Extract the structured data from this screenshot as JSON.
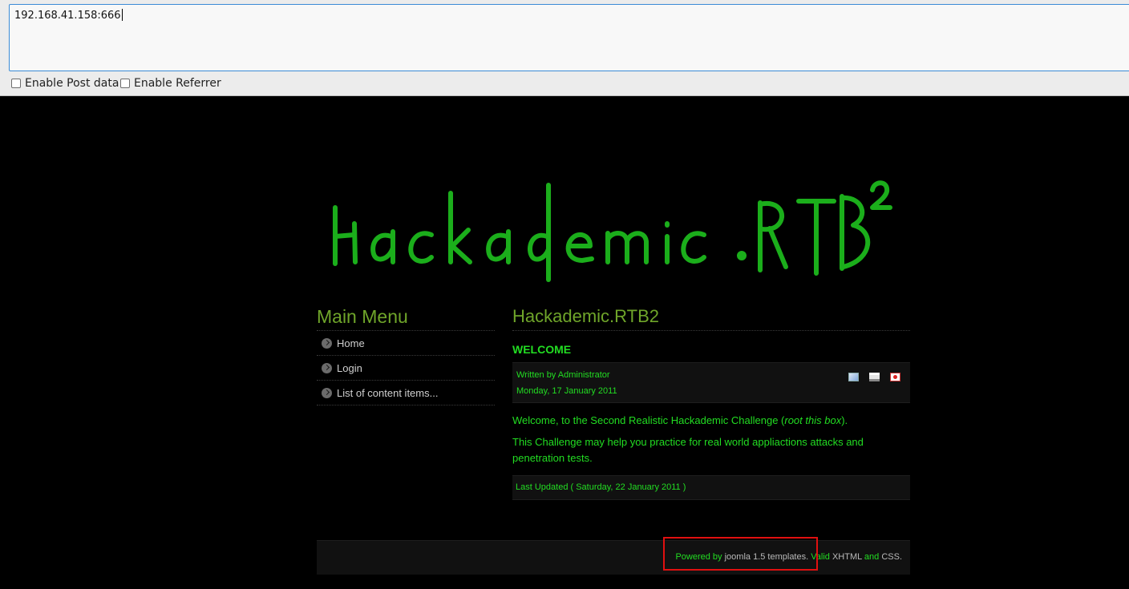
{
  "toolbar": {
    "url_value": "192.168.41.158:666",
    "enable_post_label": "Enable Post data",
    "enable_referrer_label": "Enable Referrer"
  },
  "logo": {
    "text": "Hackademic.RTB",
    "superscript": "2",
    "color": "#1fc11f"
  },
  "menu": {
    "title": "Main Menu",
    "items": [
      {
        "label": "Home"
      },
      {
        "label": "Login"
      },
      {
        "label": "List of content items..."
      }
    ]
  },
  "article": {
    "page_title": "Hackademic.RTB2",
    "heading": "WELCOME",
    "written_by": "Written by Administrator",
    "date": "Monday, 17 January 2011",
    "paragraph1_before": "Welcome, to the Second Realistic Hackademic Challenge (",
    "paragraph1_em": "root this box",
    "paragraph1_after": ").",
    "paragraph2": "This Challenge may help you practice for real world appliactions attacks and penetration tests.",
    "last_updated": "Last Updated ( Saturday, 22 January 2011 )",
    "icons": [
      "email-icon",
      "print-icon",
      "pdf-icon"
    ]
  },
  "footer": {
    "powered_by": "Powered by",
    "joomla": "joomla 1.5 templates",
    "dot": ".",
    "valid": "Valid",
    "xhtml": "XHTML",
    "and": "and",
    "css": "CSS",
    "end": "."
  },
  "colors": {
    "accent_green": "#22dd22",
    "title_green": "#6fa52a",
    "highlight_red": "#e01010"
  }
}
